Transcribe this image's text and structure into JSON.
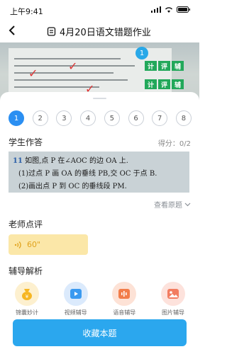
{
  "status_bar": {
    "time": "上午9:41"
  },
  "header": {
    "title": "4月20日语文错题作业"
  },
  "photo": {
    "marker_number": "1",
    "tags_row1": [
      "计",
      "评",
      "辅"
    ],
    "tags_row2": [
      "计",
      "评",
      "辅"
    ]
  },
  "questions": [
    "1",
    "2",
    "3",
    "4",
    "5",
    "6",
    "7",
    "8"
  ],
  "active_question": "1",
  "student_answer": {
    "title": "学生作答",
    "score_label": "得分：0/2",
    "lines": [
      {
        "num": "11",
        "text": " 如图,点 P 在∠AOC 的边 OA 上."
      },
      {
        "num": "",
        "text": "(1)过点 P 画 OA 的垂线 PB,交 OC 于点 B."
      },
      {
        "num": "",
        "text": "(2)画出点 P 到 OC 的垂线段 PM."
      }
    ],
    "view_original": "查看原题"
  },
  "teacher_comment": {
    "title": "老师点评",
    "audio_duration": "60\""
  },
  "tutoring": {
    "title": "辅导解析",
    "tools": [
      {
        "label": "锦囊妙计",
        "icon": "bag-icon",
        "color": "#f6b623"
      },
      {
        "label": "视频辅导",
        "icon": "video-play-icon",
        "color": "#3a9af0"
      },
      {
        "label": "语音辅导",
        "icon": "voice-icon",
        "color": "#f27d4a"
      },
      {
        "label": "图片辅导",
        "icon": "image-icon",
        "color": "#f27d61"
      }
    ]
  },
  "collect_button": "收藏本题"
}
